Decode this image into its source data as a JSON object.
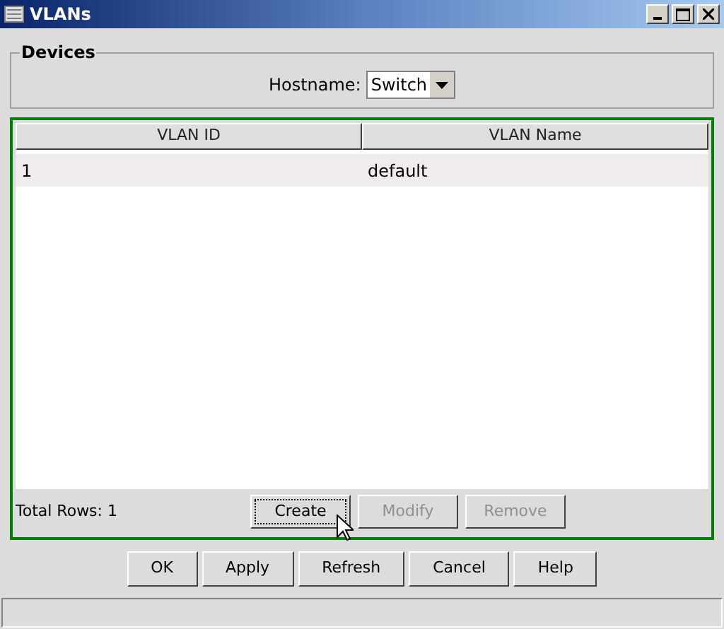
{
  "window": {
    "title": "VLANs"
  },
  "devices": {
    "legend": "Devices",
    "hostname_label": "Hostname:",
    "hostname_value": "Switch"
  },
  "table": {
    "columns": [
      "VLAN ID",
      "VLAN Name"
    ],
    "rows": [
      {
        "cells": [
          "1",
          "default"
        ],
        "selected": true
      }
    ]
  },
  "total_rows": "Total Rows: 1",
  "table_buttons": [
    {
      "label": "Create",
      "disabled": false,
      "focused": true
    },
    {
      "label": "Modify",
      "disabled": true,
      "focused": false
    },
    {
      "label": "Remove",
      "disabled": true,
      "focused": false
    }
  ],
  "dialog_buttons": [
    "OK",
    "Apply",
    "Refresh",
    "Cancel",
    "Help"
  ]
}
